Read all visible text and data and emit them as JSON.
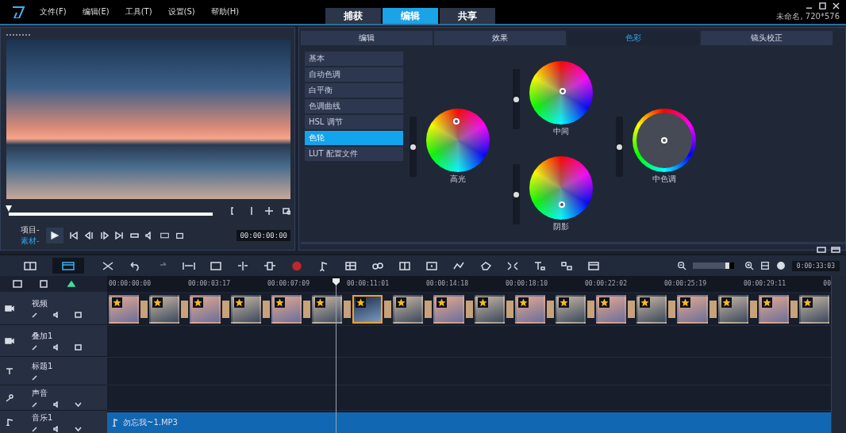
{
  "app": {
    "menu": [
      "文件(F)",
      "编辑(E)",
      "工具(T)",
      "设置(S)",
      "帮助(H)"
    ],
    "project_info": "未命名, 720*576"
  },
  "mode_tabs": [
    {
      "label": "捕获",
      "selected": false
    },
    {
      "label": "编辑",
      "selected": true
    },
    {
      "label": "共享",
      "selected": false
    }
  ],
  "preview": {
    "scrubber": {
      "level": 0
    },
    "modes": [
      {
        "label": "项目-",
        "selected": false
      },
      {
        "label": "素材-",
        "selected": true
      }
    ],
    "timecode": "00:00:00:00"
  },
  "options": {
    "tabs": [
      {
        "label": "编辑",
        "selected": false
      },
      {
        "label": "效果",
        "selected": false
      },
      {
        "label": "色彩",
        "selected": true
      },
      {
        "label": "镜头校正",
        "selected": false
      }
    ],
    "categories": [
      {
        "label": "基本",
        "selected": false
      },
      {
        "label": "自动色调",
        "selected": false
      },
      {
        "label": "白平衡",
        "selected": false
      },
      {
        "label": "色调曲线",
        "selected": false
      },
      {
        "label": "HSL 调节",
        "selected": false
      },
      {
        "label": "色轮",
        "selected": true
      },
      {
        "label": "LUT 配置文件",
        "selected": false
      }
    ],
    "wheels": [
      {
        "label": "高光",
        "kind": "wheel",
        "level": 0.5
      },
      {
        "label": "中间",
        "kind": "wheel",
        "level": 0.5
      },
      {
        "label": "阴影",
        "kind": "wheel",
        "level": 0.5
      },
      {
        "label": "中色调",
        "kind": "ring",
        "level": 0.5
      }
    ]
  },
  "timeline": {
    "zoom": {
      "level": 0.8
    },
    "duration": "0:00:33:03",
    "ruler": [
      "00:00:00:00",
      "00:00:03:17",
      "00:00:07:09",
      "00:00:11:01",
      "00:00:14:18",
      "00:00:18:10",
      "00:00:22:02",
      "00:00:25:19",
      "00:00:29:11",
      "00"
    ],
    "tracks": [
      {
        "name": "视频",
        "kind": "video"
      },
      {
        "name": "叠加1",
        "kind": "overlay"
      },
      {
        "name": "标题1",
        "kind": "title"
      },
      {
        "name": "声音",
        "kind": "voice"
      },
      {
        "name": "音乐1",
        "kind": "music"
      }
    ],
    "clips": [
      {
        "selected": false
      },
      {
        "selected": false
      },
      {
        "selected": false
      },
      {
        "selected": false
      },
      {
        "selected": false
      },
      {
        "selected": false
      },
      {
        "selected": true
      },
      {
        "selected": false
      },
      {
        "selected": false
      },
      {
        "selected": false
      },
      {
        "selected": false
      },
      {
        "selected": false
      },
      {
        "selected": false
      },
      {
        "selected": false
      },
      {
        "selected": false
      },
      {
        "selected": false
      },
      {
        "selected": false
      },
      {
        "selected": false
      }
    ],
    "music_clip": "勿忘我~1.MP3"
  }
}
